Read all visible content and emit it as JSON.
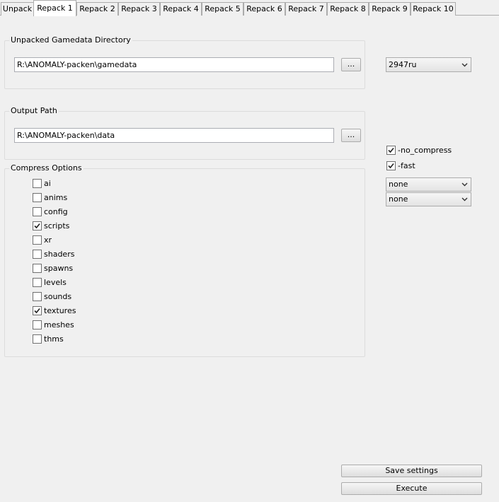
{
  "tabs": [
    {
      "label": "Unpack"
    },
    {
      "label": "Repack 1"
    },
    {
      "label": "Repack 2"
    },
    {
      "label": "Repack 3"
    },
    {
      "label": "Repack 4"
    },
    {
      "label": "Repack 5"
    },
    {
      "label": "Repack 6"
    },
    {
      "label": "Repack 7"
    },
    {
      "label": "Repack 8"
    },
    {
      "label": "Repack 9"
    },
    {
      "label": "Repack 10"
    }
  ],
  "active_tab": "Repack 1",
  "unpacked": {
    "title": "Unpacked Gamedata Directory",
    "path": "R:\\ANOMALY-packen\\gamedata",
    "browse_label": "..."
  },
  "output": {
    "title": "Output Path",
    "path": "R:\\ANOMALY-packen\\data",
    "browse_label": "..."
  },
  "version_select": {
    "selected": "2947ru"
  },
  "flags": [
    {
      "label": "-no_compress",
      "checked": true
    },
    {
      "label": "-fast",
      "checked": true
    }
  ],
  "extra_selects": [
    {
      "selected": "none"
    },
    {
      "selected": "none"
    }
  ],
  "compress": {
    "title": "Compress Options",
    "options": [
      {
        "label": "ai",
        "checked": false
      },
      {
        "label": "anims",
        "checked": false
      },
      {
        "label": "config",
        "checked": false
      },
      {
        "label": "scripts",
        "checked": true
      },
      {
        "label": "xr",
        "checked": false
      },
      {
        "label": "shaders",
        "checked": false
      },
      {
        "label": "spawns",
        "checked": false
      },
      {
        "label": "levels",
        "checked": false
      },
      {
        "label": "sounds",
        "checked": false
      },
      {
        "label": "textures",
        "checked": true
      },
      {
        "label": "meshes",
        "checked": false
      },
      {
        "label": "thms",
        "checked": false
      }
    ]
  },
  "buttons": {
    "save_label": "Save settings",
    "execute_label": "Execute"
  }
}
